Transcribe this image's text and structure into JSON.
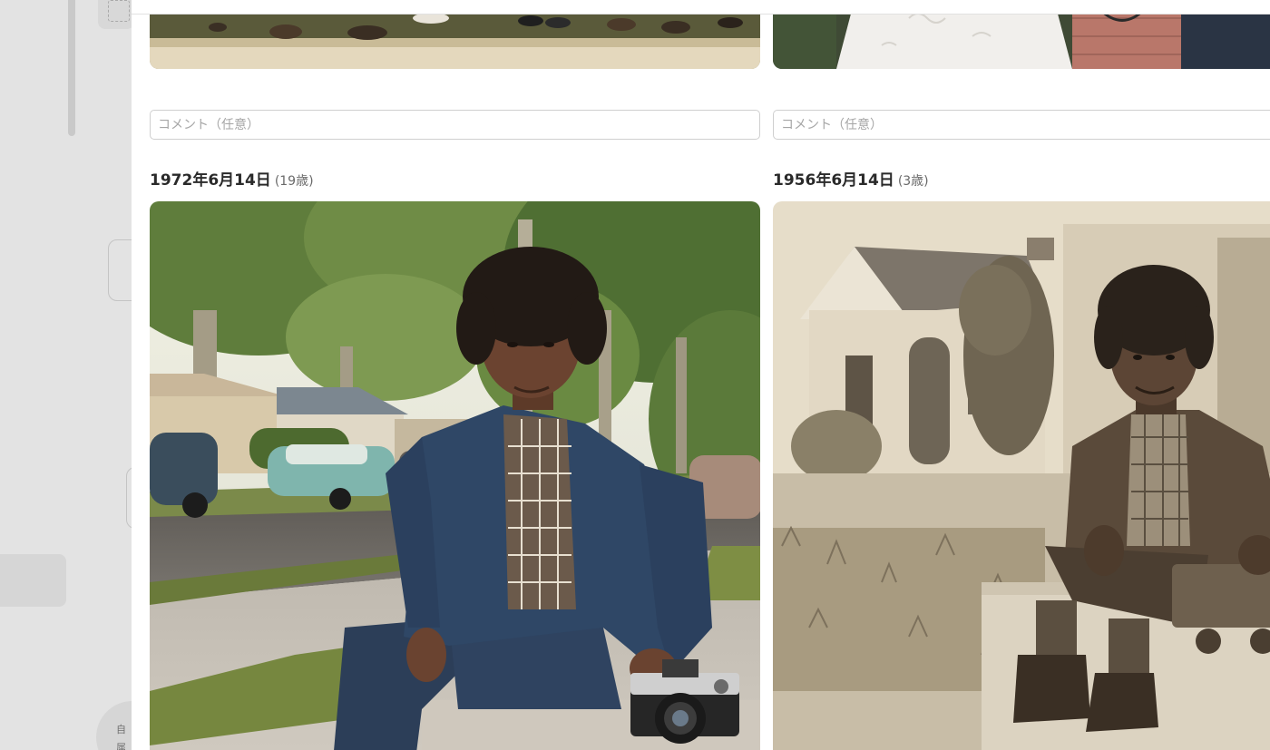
{
  "background": {
    "circle_label": "自\n属"
  },
  "entries": [
    {
      "comment_placeholder": "コメント（任意）",
      "date": "1972年6月14日",
      "age": "(19歳)",
      "photo_style": "color"
    },
    {
      "comment_placeholder": "コメント（任意）",
      "date": "1956年6月14日",
      "age": "(3歳)",
      "photo_style": "sepia"
    }
  ]
}
